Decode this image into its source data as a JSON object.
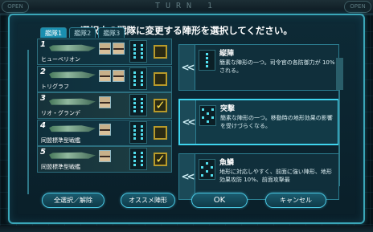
{
  "topbar": {
    "turn_label": "TURN 1",
    "left_button": "OPEN",
    "right_button": "OPEN"
  },
  "dialog": {
    "title": "選択中の戦隊に変更する陣形を選択してください。",
    "tabs": [
      "艦隊1",
      "艦隊2",
      "艦隊3"
    ],
    "active_tab": 0
  },
  "ships": [
    {
      "number": "1",
      "name": "ヒューベリオン",
      "portraits": 2,
      "checked": false
    },
    {
      "number": "2",
      "name": "トリグラフ",
      "portraits": 2,
      "checked": false
    },
    {
      "number": "3",
      "name": "リオ・グランデ",
      "portraits": 1,
      "checked": true
    },
    {
      "number": "4",
      "name": "同盟標準型戦艦",
      "portraits": 1,
      "checked": false
    },
    {
      "number": "5",
      "name": "同盟標準型戦艦",
      "portraits": 1,
      "checked": true
    }
  ],
  "formations": [
    {
      "name": "縦陣",
      "desc": "簡素な陣形の一つ。司令官の各防御力が 10%される。",
      "selected": false
    },
    {
      "name": "突撃",
      "desc": "簡素な陣形の一つ。移動時の地形効果の影響を受けづらくなる。",
      "selected": true
    },
    {
      "name": "魚鱗",
      "desc": "地形に対応しやすく、前面に強い陣形、地形効果攻防 10%、前面攻撃最",
      "selected": false
    }
  ],
  "buttons": {
    "select_all": "全選択／解除",
    "recommended": "オススメ陣形",
    "ok": "OK",
    "cancel": "キャンセル"
  },
  "colors": {
    "accent": "#3aa6b8",
    "highlight": "#3fd4ee",
    "check": "#ffe14a"
  }
}
